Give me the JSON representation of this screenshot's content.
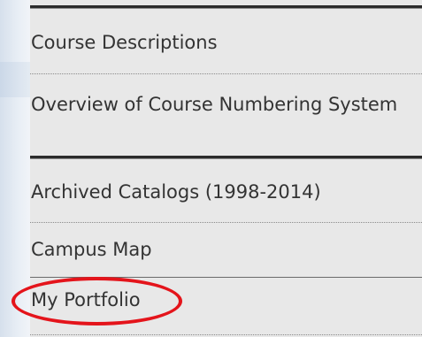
{
  "nav": {
    "items": [
      {
        "label": "Course Descriptions"
      },
      {
        "label": "Overview of Course Numbering System"
      },
      {
        "label": "Archived Catalogs (1998-2014)"
      },
      {
        "label": "Campus Map"
      },
      {
        "label": "My Portfolio"
      }
    ]
  },
  "colors": {
    "menu_background": "#e8e8e8",
    "text": "#333333",
    "highlight_ring": "#e4141b"
  }
}
